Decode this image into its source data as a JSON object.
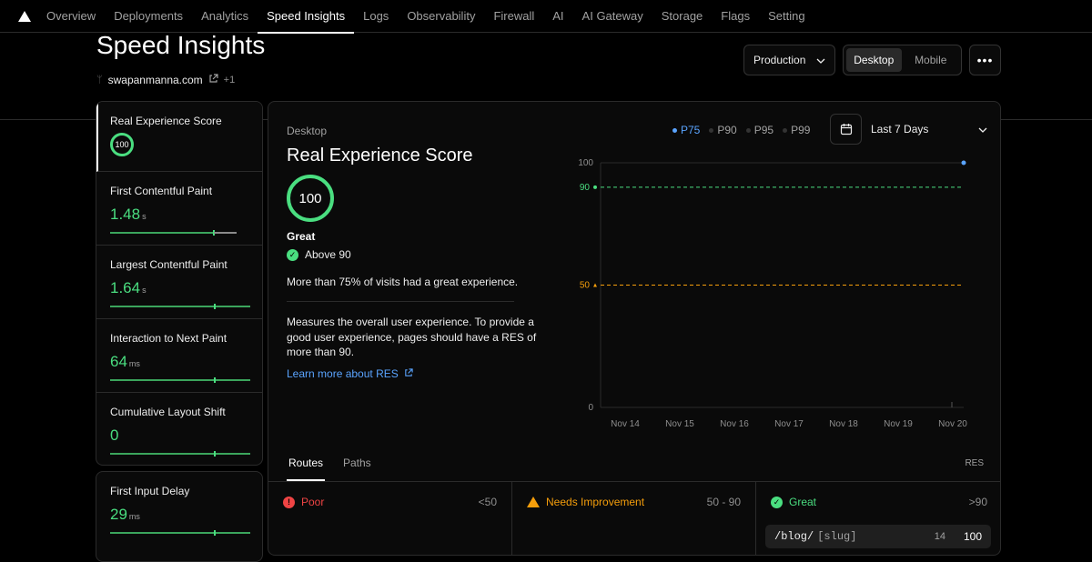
{
  "nav": {
    "items": [
      {
        "label": "Overview"
      },
      {
        "label": "Deployments"
      },
      {
        "label": "Analytics"
      },
      {
        "label": "Speed Insights"
      },
      {
        "label": "Logs"
      },
      {
        "label": "Observability"
      },
      {
        "label": "Firewall"
      },
      {
        "label": "AI"
      },
      {
        "label": "AI Gateway"
      },
      {
        "label": "Storage"
      },
      {
        "label": "Flags"
      },
      {
        "label": "Setting"
      }
    ],
    "active": "Speed Insights"
  },
  "header": {
    "title": "Speed Insights",
    "domain": "swapanmanna.com",
    "domain_extra": "+1",
    "environment": "Production",
    "device_options": [
      "Desktop",
      "Mobile"
    ],
    "device_selected": "Desktop",
    "more_label": "•••"
  },
  "sidebar": {
    "metrics": [
      {
        "label": "Real Experience Score",
        "value": "100",
        "unit": "",
        "selected": true
      },
      {
        "label": "First Contentful Paint",
        "value": "1.48",
        "unit": "s"
      },
      {
        "label": "Largest Contentful Paint",
        "value": "1.64",
        "unit": "s"
      },
      {
        "label": "Interaction to Next Paint",
        "value": "64",
        "unit": "ms"
      },
      {
        "label": "Cumulative Layout Shift",
        "value": "0",
        "unit": ""
      },
      {
        "label": "First Input Delay",
        "value": "29",
        "unit": "ms"
      }
    ]
  },
  "detail": {
    "device": "Desktop",
    "title": "Real Experience Score",
    "score": "100",
    "rating": "Great",
    "threshold": "Above 90",
    "visits_text": "More than 75% of visits had a great experience.",
    "description": "Measures the overall user experience. To provide a good user experience, pages should have a RES of more than 90.",
    "learn_more": "Learn more about RES"
  },
  "percentiles": [
    {
      "label": "P75",
      "active": true
    },
    {
      "label": "P90",
      "active": false
    },
    {
      "label": "P95",
      "active": false
    },
    {
      "label": "P99",
      "active": false
    }
  ],
  "date_range": "Last 7 Days",
  "chart_data": {
    "type": "line",
    "x": [
      "Nov 14",
      "Nov 15",
      "Nov 16",
      "Nov 17",
      "Nov 18",
      "Nov 19",
      "Nov 20"
    ],
    "yticks": [
      "0",
      "50",
      "90",
      "100"
    ],
    "ylim": [
      0,
      100
    ],
    "thresholds": [
      {
        "value": 90,
        "label": "90",
        "color": "#4ade80"
      },
      {
        "value": 50,
        "label": "50",
        "color": "#f59e0b"
      }
    ],
    "series": [
      {
        "values": [
          null,
          null,
          null,
          null,
          null,
          null,
          100
        ],
        "color": "#5aa4ff"
      }
    ]
  },
  "routes": {
    "tabs": [
      "Routes",
      "Paths"
    ],
    "active_tab": "Routes",
    "metric_label": "RES",
    "columns": [
      {
        "label": "Poor",
        "range": "<50",
        "color": "#ef4444"
      },
      {
        "label": "Needs Improvement",
        "range": "50 - 90",
        "color": "#f59e0b"
      },
      {
        "label": "Great",
        "range": ">90",
        "color": "#4ade80"
      }
    ],
    "great_rows": [
      {
        "path": "/blog/",
        "segment": "[slug]",
        "count": "14",
        "score": "100"
      }
    ]
  }
}
